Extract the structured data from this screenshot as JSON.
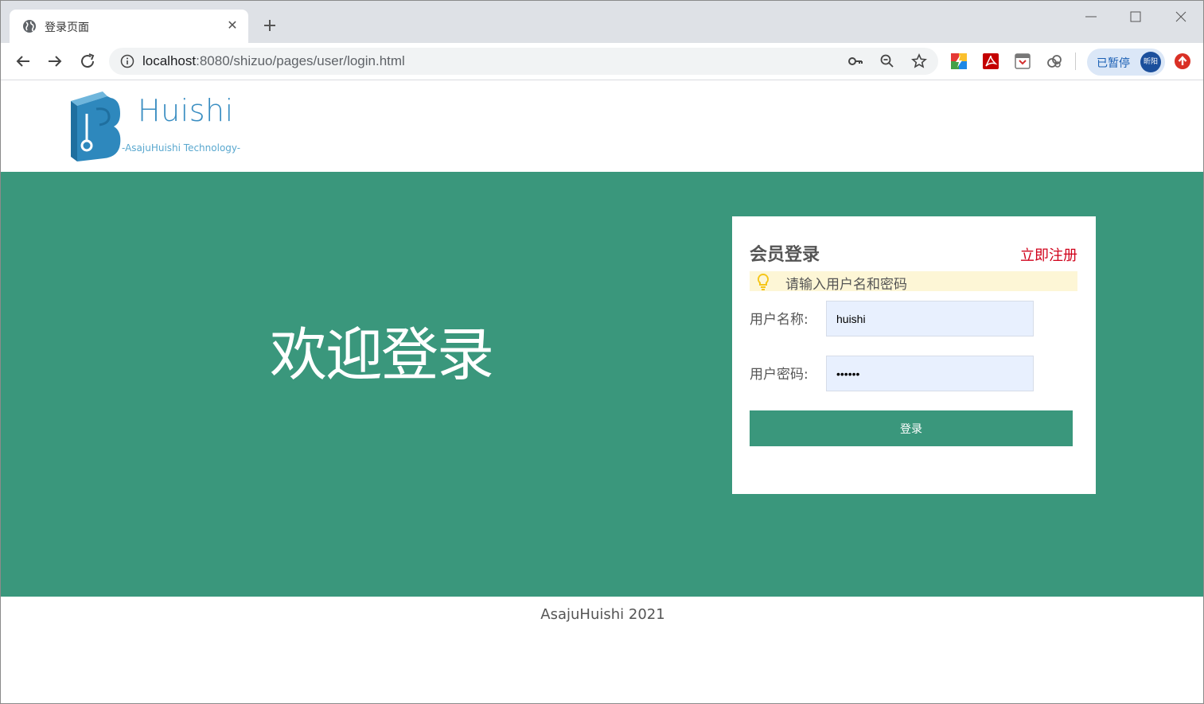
{
  "browser": {
    "tab_title": "登录页面",
    "url_host": "localhost",
    "url_rest": ":8080/shizuo/pages/user/login.html",
    "profile_status": "已暂停",
    "profile_avatar_text": "昕阳"
  },
  "header": {
    "logo_text": "Huishi",
    "logo_subtitle": "-AsajuHuishi Technology-",
    "logo_color": "#3a8ec2"
  },
  "banner": {
    "welcome_text": "欢迎登录",
    "background_color": "#3a977c"
  },
  "login": {
    "title": "会员登录",
    "register_link": "立即注册",
    "hint": "请输入用户名和密码",
    "username_label": "用户名称:",
    "username_value": "huishi",
    "password_label": "用户密码:",
    "password_value": "123456",
    "submit_label": "登录"
  },
  "footer": {
    "text": "AsajuHuishi 2021"
  }
}
